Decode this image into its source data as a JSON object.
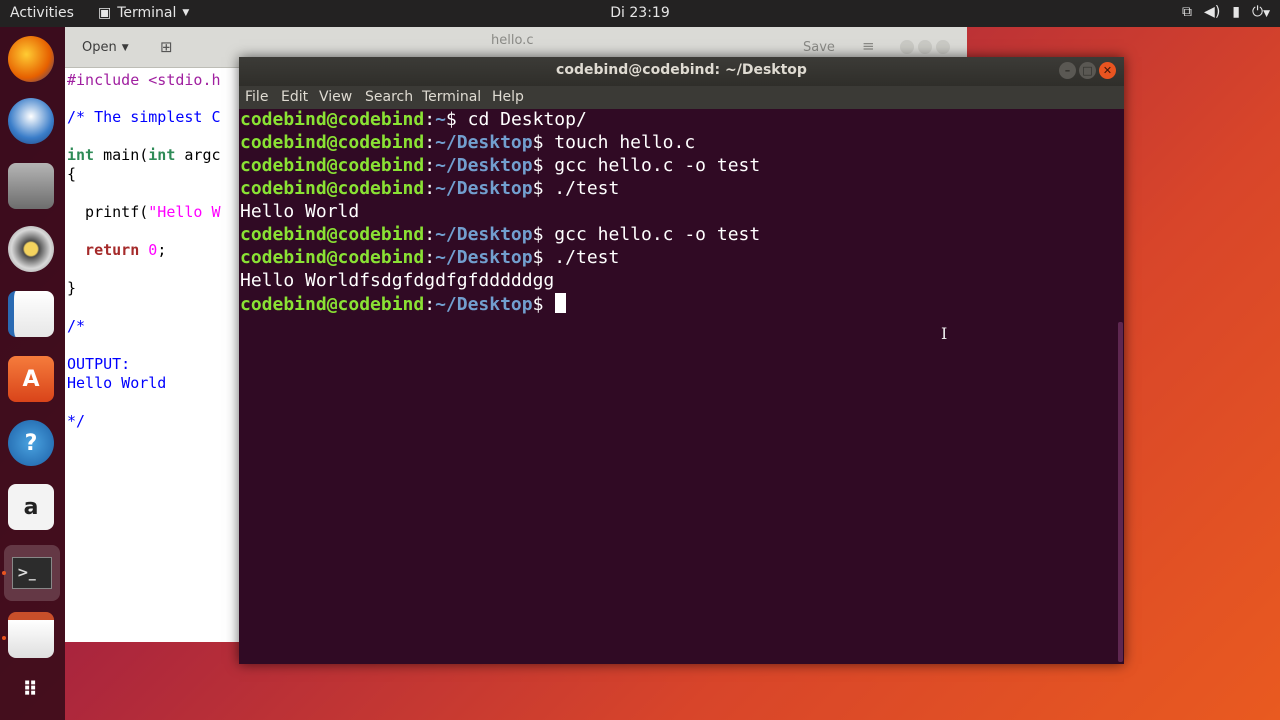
{
  "topbar": {
    "activities": "Activities",
    "app_menu": "Terminal",
    "clock": "Di 23:19",
    "tray_icons": [
      "network-icon",
      "volume-icon",
      "battery-icon",
      "power-icon"
    ]
  },
  "dock": {
    "items": [
      "firefox-icon",
      "thunderbird-icon",
      "files-icon",
      "rhythmbox-icon",
      "writer-icon",
      "software-center-icon",
      "help-icon",
      "amazon-icon",
      "terminal-icon",
      "text-editor-icon",
      "show-apps-icon"
    ],
    "amazon_label": "a",
    "help_label": "?"
  },
  "gedit": {
    "open_label": "Open",
    "title": "hello.c",
    "save_label": "Save",
    "code": {
      "l1": "#include <stdio.h",
      "l2": "/* The simplest C",
      "l3_type": "int",
      "l3_mid": " main(",
      "l3_type2": "int",
      "l3_end": " argc",
      "l4": "{",
      "l5_fn": "  printf(",
      "l5_str": "\"Hello W",
      "l6_kw": "  return",
      "l6_sp": " ",
      "l6_num": "0",
      "l6_end": ";",
      "l7": "}",
      "l8": "/*",
      "l9": "OUTPUT:",
      "l10": "Hello World",
      "l11": "*/"
    }
  },
  "terminal": {
    "title": "codebind@codebind: ~/Desktop",
    "menu": [
      "File",
      "Edit",
      "View",
      "Search",
      "Terminal",
      "Help"
    ],
    "user": "codebind@codebind",
    "lines": [
      {
        "path": "~",
        "cmd": " cd Desktop/"
      },
      {
        "path": "~/Desktop",
        "cmd": " touch hello.c"
      },
      {
        "path": "~/Desktop",
        "cmd": " gcc hello.c -o test"
      },
      {
        "path": "~/Desktop",
        "cmd": " ./test"
      },
      {
        "output": "Hello World"
      },
      {
        "path": "~/Desktop",
        "cmd": " gcc hello.c -o test"
      },
      {
        "path": "~/Desktop",
        "cmd": " ./test"
      },
      {
        "output": "Hello Worldfsdgfdgdfgfdddddgg"
      },
      {
        "path": "~/Desktop",
        "cmd": " "
      }
    ],
    "colon": ":",
    "dollar": "$"
  },
  "colors": {
    "ubuntu_orange": "#e95420",
    "terminal_bg": "#300a24",
    "prompt_green": "#8ae234",
    "prompt_blue": "#729fcf"
  }
}
